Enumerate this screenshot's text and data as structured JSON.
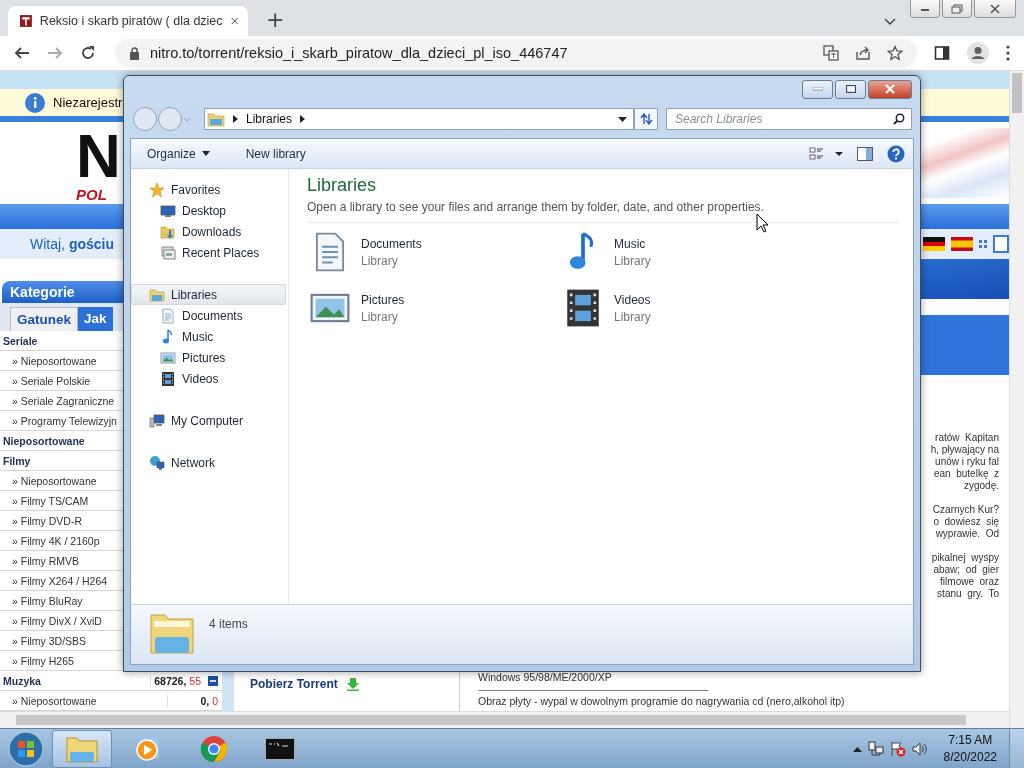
{
  "browser": {
    "tab_title": "Reksio i skarb piratów ( dla dziec",
    "new_tab": "+",
    "url": "nitro.to/torrent/reksio_i_skarb_piratow_dla_dzieci_pl_iso_446747"
  },
  "page": {
    "notice": "Niezarejestr",
    "logo_top": "N",
    "logo_bottom": "POL",
    "welcome": "Witaj, **gościu**",
    "categories_title": "Kategorie",
    "category_tabs": [
      {
        "label": "Gatunek",
        "selected": true
      },
      {
        "label": "Jak",
        "selected": false
      }
    ],
    "categories": [
      {
        "name": "Seriale",
        "children": [
          {
            "name": "» Nieposortowane"
          },
          {
            "name": "» Seriale Polskie"
          },
          {
            "name": "» Seriale Zagraniczne"
          },
          {
            "name": "» Programy Telewizyjn"
          }
        ]
      },
      {
        "name": "Nieposortowane"
      },
      {
        "name": "Filmy",
        "children": [
          {
            "name": "» Nieposortowane"
          },
          {
            "name": "» Filmy TS/CAM"
          },
          {
            "name": "» Filmy DVD-R"
          },
          {
            "name": "» Filmy 4K / 2160p"
          },
          {
            "name": "» Filmy RMVB"
          },
          {
            "name": "» Filmy X264 / H264"
          },
          {
            "name": "» Filmy BluRay"
          },
          {
            "name": "» Filmy DivX / XviD"
          },
          {
            "name": "» Filmy 3D/SBS"
          },
          {
            "name": "» Filmy H265"
          }
        ]
      },
      {
        "name": "Muzyka",
        "count": "68726,",
        "new_count": "55",
        "expanded": true,
        "children": [
          {
            "name": "» Nieposortowane",
            "count": "0,",
            "new_count": "0"
          }
        ]
      }
    ],
    "download_link": "Pobierz Torrent",
    "description": [
      [
        "ratów  Kapitan",
        "h, pływający na",
        "unów i ryku fal",
        "ean  butelkę  z",
        "zygodę."
      ],
      [
        "Czarnych Kur?",
        "o  dowiesz  się",
        "wyprawie.  Od"
      ],
      [
        "pikalnej  wyspy",
        "abaw;  od  gier",
        "filmowe  oraz",
        "stanu  gry.  To"
      ]
    ],
    "requirements": "Windows 95/98/ME/2000/XP",
    "separator": "--------------------------------------------------------------------------------------------",
    "instructions": "Obraz płyty - wypal w dowolnym programie do nagrywania cd (nero,alkohol itp)"
  },
  "explorer": {
    "breadcrumb": "Libraries",
    "search_placeholder": "Search Libraries",
    "commands": [
      {
        "label": "Organize",
        "kind": "menu"
      },
      {
        "label": "New library",
        "kind": "button"
      }
    ],
    "nav": [
      {
        "label": "Favorites",
        "kind": "star",
        "selected": false,
        "children": [
          {
            "label": "Desktop",
            "kind": "desktop",
            "selected": false
          },
          {
            "label": "Downloads",
            "kind": "downloads",
            "selected": false
          },
          {
            "label": "Recent Places",
            "kind": "recent",
            "selected": false
          }
        ]
      },
      {
        "label": "Libraries",
        "kind": "library",
        "selected": true,
        "children": [
          {
            "label": "Documents",
            "kind": "documents",
            "selected": false
          },
          {
            "label": "Music",
            "kind": "music",
            "selected": false
          },
          {
            "label": "Pictures",
            "kind": "pictures",
            "selected": false
          },
          {
            "label": "Videos",
            "kind": "videos",
            "selected": false
          }
        ]
      },
      {
        "label": "My Computer",
        "kind": "computer",
        "selected": false
      },
      {
        "label": "Network",
        "kind": "network",
        "selected": false
      }
    ],
    "heading": "Libraries",
    "subtitle": "Open a library to see your files and arrange them by folder, date, and other properties.",
    "items": [
      {
        "name": "Documents",
        "type": "Library",
        "kind": "documents"
      },
      {
        "name": "Music",
        "type": "Library",
        "kind": "music"
      },
      {
        "name": "Pictures",
        "type": "Library",
        "kind": "pictures"
      },
      {
        "name": "Videos",
        "type": "Library",
        "kind": "videos"
      }
    ],
    "status": "4 items"
  },
  "taskbar": {
    "apps": [
      {
        "kind": "explorer",
        "selected": true
      },
      {
        "kind": "media",
        "selected": false
      },
      {
        "kind": "chrome",
        "selected": false
      },
      {
        "kind": "terminal",
        "selected": false
      }
    ],
    "time": "7:15 AM",
    "date": "8/20/2022"
  }
}
